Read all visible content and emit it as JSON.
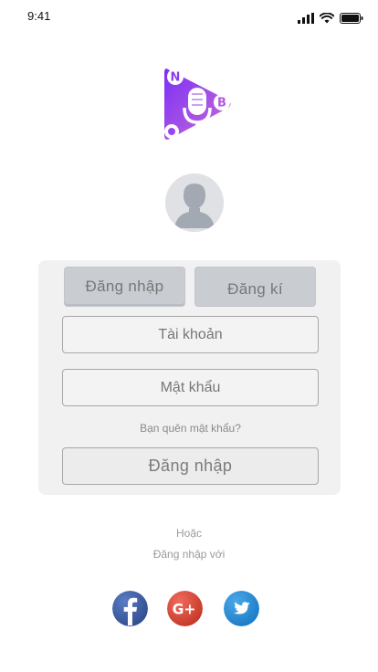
{
  "status_bar": {
    "time": "9:41"
  },
  "logo": {
    "letters": {
      "top_left": "N",
      "right": "B",
      "bottom": "O"
    },
    "colors": {
      "gradient_start": "#7b2ff7",
      "gradient_end": "#c86dd7"
    }
  },
  "auth_tabs": {
    "login_label": "Đăng nhập",
    "register_label": "Đăng kí"
  },
  "form": {
    "username_placeholder": "Tài khoản",
    "password_placeholder": "Mật khẩu",
    "forgot_password": "Bạn quên mật khẩu?",
    "submit_label": "Đăng nhập"
  },
  "alternate": {
    "or_text": "Hoặc",
    "login_with_text": "Đăng nhập với"
  },
  "social": [
    {
      "icon": "facebook-icon",
      "color": "#3b5998"
    },
    {
      "icon": "google-plus-icon",
      "color": "#dc4e41"
    },
    {
      "icon": "twitter-icon",
      "color": "#1da1f2"
    }
  ]
}
